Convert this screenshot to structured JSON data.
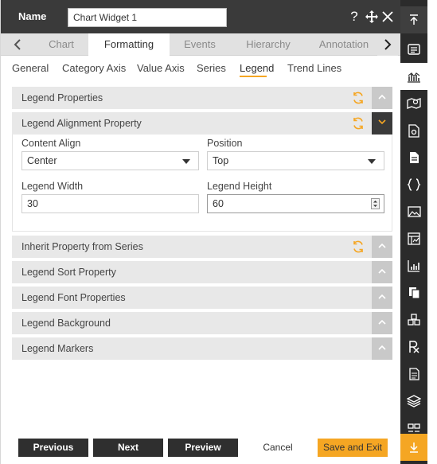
{
  "header": {
    "name_label": "Name",
    "name_value": "Chart Widget 1",
    "icons": [
      "help-icon",
      "move-icon",
      "close-icon"
    ]
  },
  "tabs": {
    "items": [
      "Chart",
      "Formatting",
      "Events",
      "Hierarchy",
      "Annotation"
    ],
    "active": "Formatting"
  },
  "subtabs": {
    "items": [
      "General",
      "Category Axis",
      "Value Axis",
      "Series",
      "Legend",
      "Trend Lines"
    ],
    "active": "Legend"
  },
  "sections": {
    "legend_properties": "Legend Properties",
    "legend_alignment": "Legend Alignment Property",
    "inherit_property": "Inherit Property from Series",
    "legend_sort": "Legend Sort Property",
    "legend_font": "Legend Font Properties",
    "legend_background": "Legend Background",
    "legend_markers": "Legend Markers"
  },
  "alignment": {
    "content_align_label": "Content Align",
    "content_align_value": "Center",
    "position_label": "Position",
    "position_value": "Top",
    "legend_width_label": "Legend Width",
    "legend_width_value": "30",
    "legend_height_label": "Legend Height",
    "legend_height_value": "60"
  },
  "footer": {
    "previous": "Previous",
    "next": "Next",
    "preview": "Preview",
    "cancel": "Cancel",
    "save_exit": "Save and Exit"
  },
  "rail_icons": [
    "scroll-top-icon",
    "list-panel-icon",
    "chart-icon",
    "map-icon",
    "document-settings-icon",
    "file-icon",
    "json-braces-icon",
    "image-icon",
    "table-icon",
    "kpi-chart-icon",
    "copy-icon",
    "cubes-icon",
    "rx-icon",
    "report-icon",
    "layers-icon",
    "grid-icon",
    "scroll-bottom-icon"
  ],
  "colors": {
    "accent": "#f5a623",
    "header": "#3a3a3a",
    "rail": "#2b2b2b",
    "section": "#e8e8e8"
  }
}
